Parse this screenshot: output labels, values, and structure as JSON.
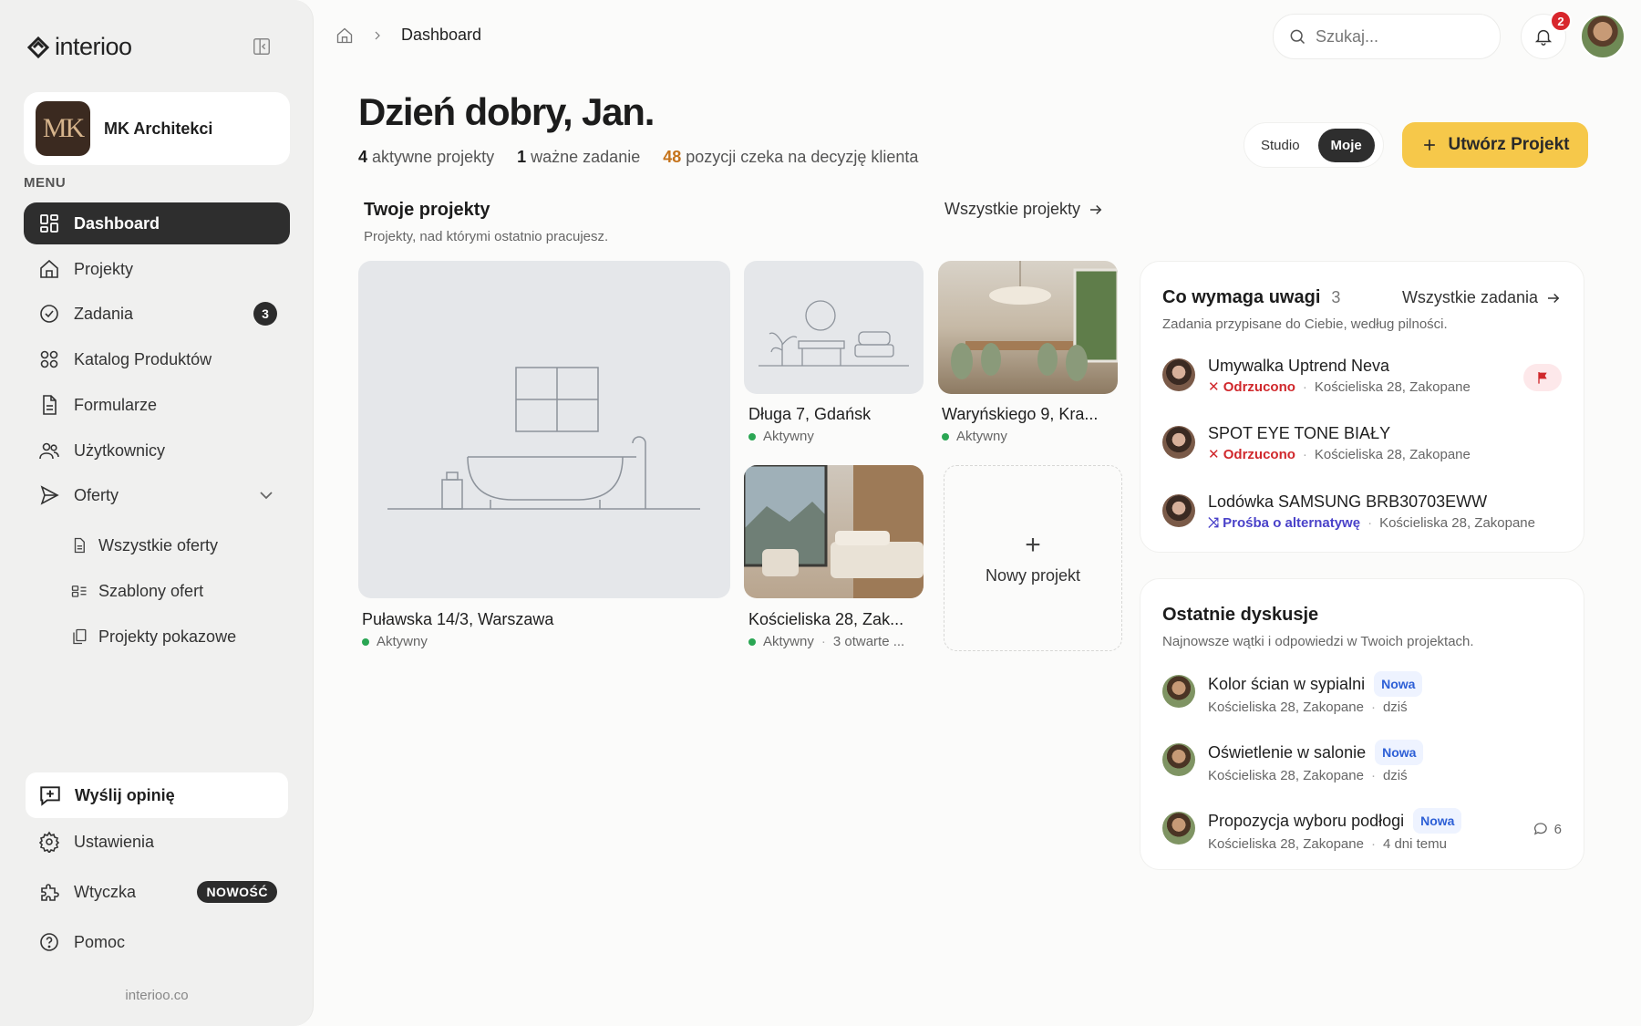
{
  "brand": {
    "logo_text": "interioo",
    "footer": "interioo.co"
  },
  "org": {
    "initials": "MK",
    "name": "MK Architekci"
  },
  "menu_label": "MENU",
  "nav": {
    "dashboard": "Dashboard",
    "projekty": "Projekty",
    "zadania": "Zadania",
    "zadania_count": "3",
    "katalog": "Katalog Produktów",
    "formularze": "Formularze",
    "uzytkownicy": "Użytkownicy",
    "oferty": "Oferty",
    "oferty_sub": [
      "Wszystkie oferty",
      "Szablony ofert",
      "Projekty pokazowe"
    ]
  },
  "bottom_nav": {
    "feedback": "Wyślij opinię",
    "settings": "Ustawienia",
    "plugin": "Wtyczka",
    "plugin_badge": "NOWOŚĆ",
    "help": "Pomoc"
  },
  "breadcrumb": {
    "current": "Dashboard"
  },
  "search": {
    "placeholder": "Szukaj..."
  },
  "notifications": {
    "count": "2"
  },
  "greeting": "Dzień dobry, Jan.",
  "stats": {
    "active_n": "4",
    "active_label": "aktywne projekty",
    "important_n": "1",
    "important_label": "ważne zadanie",
    "pending_n": "48",
    "pending_label": "pozycji czeka na decyzję klienta"
  },
  "view_toggle": {
    "studio": "Studio",
    "mine": "Moje"
  },
  "create_button": "Utwórz Projekt",
  "projects": {
    "title": "Twoje projekty",
    "subtitle": "Projekty, nad którymi ostatnio pracujesz.",
    "all_link": "Wszystkie projekty",
    "items": [
      {
        "name": "Puławska 14/3, Warszawa",
        "status": "Aktywny"
      },
      {
        "name": "Długa 7, Gdańsk",
        "status": "Aktywny"
      },
      {
        "name": "Waryńskiego 9, Kra...",
        "status": "Aktywny"
      },
      {
        "name": "Kościeliska 28, Zak...",
        "status": "Aktywny",
        "extra": "3 otwarte ..."
      }
    ],
    "new_project": "Nowy projekt"
  },
  "attention": {
    "title": "Co wymaga uwagi",
    "count": "3",
    "all_link": "Wszystkie zadania",
    "subtitle": "Zadania przypisane do Ciebie, według pilności.",
    "items": [
      {
        "product": "Umywalka Uptrend Neva",
        "state": "Odrzucono",
        "location": "Kościeliska 28, Zakopane"
      },
      {
        "product": "SPOT EYE TONE BIAŁY",
        "state": "Odrzucono",
        "location": "Kościeliska 28, Zakopane"
      },
      {
        "product": "Lodówka SAMSUNG BRB30703EWW",
        "state": "Prośba o alternatywę",
        "location": "Kościeliska 28, Zakopane"
      }
    ]
  },
  "discussions": {
    "title": "Ostatnie dyskusje",
    "subtitle": "Najnowsze wątki i odpowiedzi w Twoich projektach.",
    "items": [
      {
        "topic": "Kolor ścian w sypialni",
        "tag": "Nowa",
        "location": "Kościeliska 28, Zakopane",
        "time": "dziś"
      },
      {
        "topic": "Oświetlenie w salonie",
        "tag": "Nowa",
        "location": "Kościeliska 28, Zakopane",
        "time": "dziś"
      },
      {
        "topic": "Propozycja wyboru podłogi",
        "tag": "Nowa",
        "location": "Kościeliska 28, Zakopane",
        "time": "4 dni temu",
        "comments": "6"
      }
    ]
  },
  "colors": {
    "accent": "#f6c84a",
    "active_nav": "#2e2e2e",
    "rejected": "#d0282c",
    "alternative": "#4a42c9",
    "status_active": "#2aa653",
    "pending": "#c5731b"
  }
}
